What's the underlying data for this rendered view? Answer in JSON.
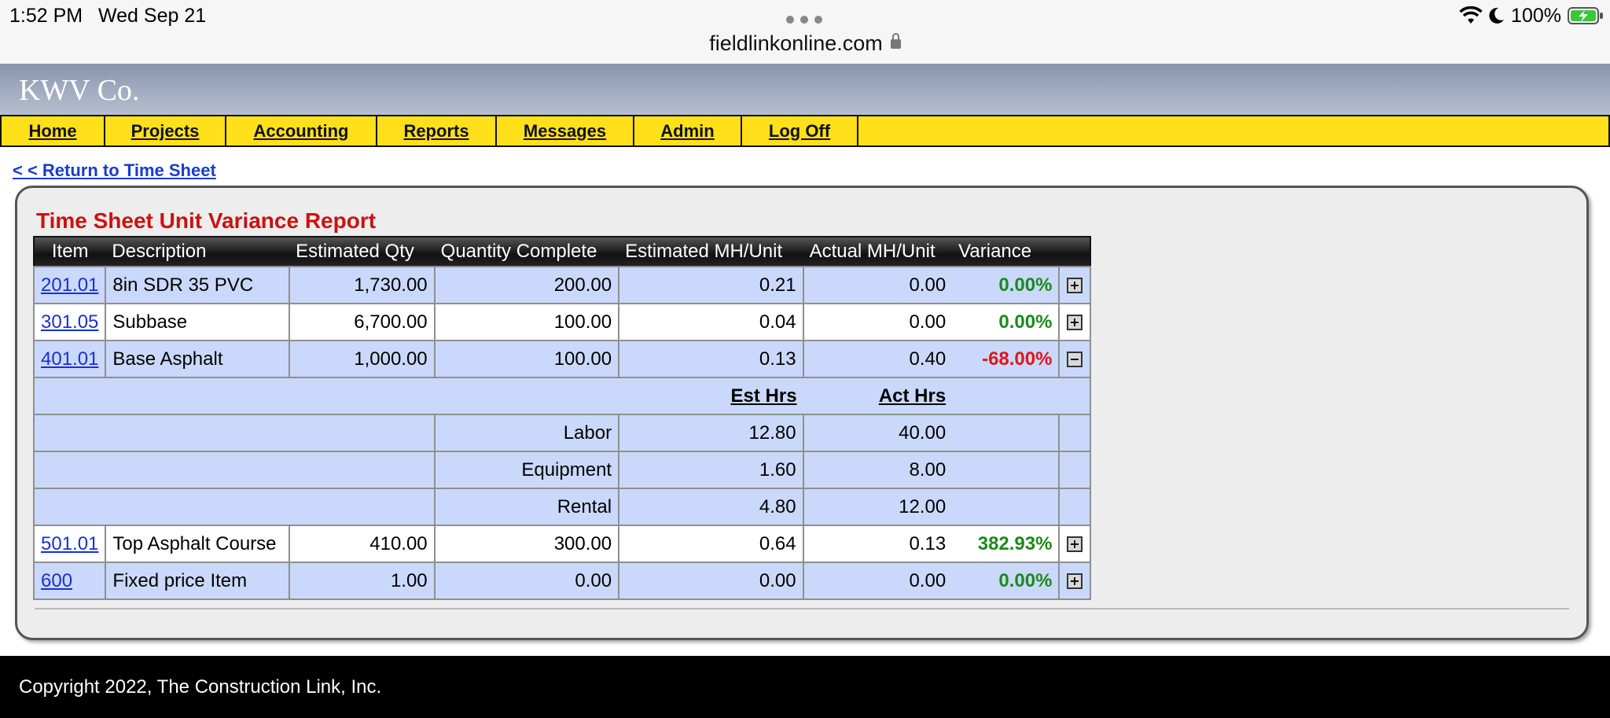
{
  "status_bar": {
    "time": "1:52 PM",
    "date": "Wed Sep 21",
    "battery_pct": "100%",
    "icons": [
      "wifi-icon",
      "moon-icon",
      "battery-charging-icon"
    ]
  },
  "browser": {
    "url": "fieldlinkonline.com",
    "lock_icon": "lock-icon"
  },
  "header": {
    "brand": "KWV Co."
  },
  "nav": {
    "items": [
      {
        "label": "Home"
      },
      {
        "label": "Projects"
      },
      {
        "label": "Accounting"
      },
      {
        "label": "Reports"
      },
      {
        "label": "Messages"
      },
      {
        "label": "Admin"
      },
      {
        "label": "Log Off"
      }
    ]
  },
  "return_link": "< < Return to Time Sheet",
  "report": {
    "title": "Time Sheet Unit Variance Report",
    "columns": [
      "Item",
      "Description",
      "Estimated Qty",
      "Quantity Complete",
      "Estimated MH/Unit",
      "Actual MH/Unit",
      "Variance"
    ],
    "rows": [
      {
        "item": "201.01",
        "description": "8in SDR 35 PVC",
        "est_qty": "1,730.00",
        "qty_complete": "200.00",
        "est_mh_unit": "0.21",
        "act_mh_unit": "0.00",
        "variance": "0.00%"
      },
      {
        "item": "301.05",
        "description": "Subbase",
        "est_qty": "6,700.00",
        "qty_complete": "100.00",
        "est_mh_unit": "0.04",
        "act_mh_unit": "0.00",
        "variance": "0.00%"
      },
      {
        "item": "401.01",
        "description": "Base Asphalt",
        "est_qty": "1,000.00",
        "qty_complete": "100.00",
        "est_mh_unit": "0.13",
        "act_mh_unit": "0.40",
        "variance": "-68.00%"
      },
      {
        "item": "501.01",
        "description": "Top Asphalt Course",
        "est_qty": "410.00",
        "qty_complete": "300.00",
        "est_mh_unit": "0.64",
        "act_mh_unit": "0.13",
        "variance": "382.93%"
      },
      {
        "item": "600",
        "description": "Fixed price Item",
        "est_qty": "1.00",
        "qty_complete": "0.00",
        "est_mh_unit": "0.00",
        "act_mh_unit": "0.00",
        "variance": "0.00%"
      }
    ],
    "detail": {
      "est_hrs_label": "Est Hrs",
      "act_hrs_label": "Act Hrs",
      "lines": [
        {
          "label": "Labor",
          "est_hrs": "12.80",
          "act_hrs": "40.00"
        },
        {
          "label": "Equipment",
          "est_hrs": "1.60",
          "act_hrs": "8.00"
        },
        {
          "label": "Rental",
          "est_hrs": "4.80",
          "act_hrs": "12.00"
        }
      ]
    }
  },
  "colors": {
    "nav_bg": "#ffe01a",
    "row_blue": "#cad9fb",
    "title_red": "#cc1111",
    "variance_positive": "#1c8a1c",
    "variance_negative": "#e0141b",
    "link_blue": "#1a2fd6"
  },
  "footer": {
    "copyright": "Copyright 2022, The Construction Link, Inc."
  }
}
